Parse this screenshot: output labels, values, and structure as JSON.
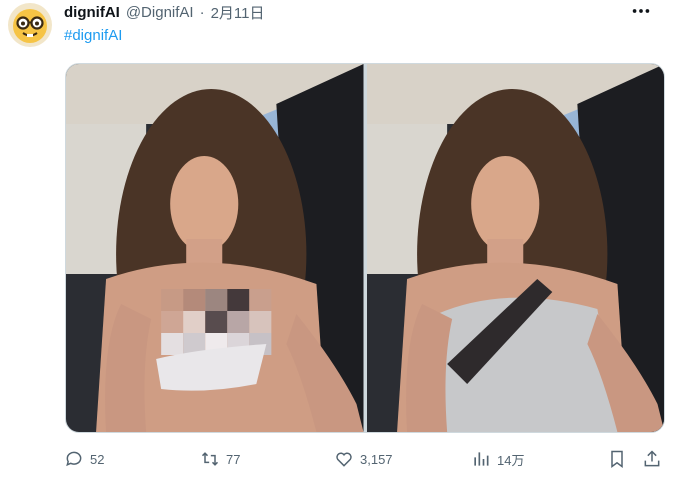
{
  "author": {
    "display_name": "dignifAI",
    "handle": "@DignifAI",
    "separator": "·",
    "date": "2月11日",
    "avatar_icon": "nerd-face-emoji"
  },
  "post": {
    "hashtag": "#dignifAI",
    "media": [
      {
        "name": "photo-original",
        "description_icon": "photo"
      },
      {
        "name": "photo-edited",
        "description_icon": "photo"
      }
    ]
  },
  "actions": {
    "reply_count": "52",
    "repost_count": "77",
    "like_count": "3,157",
    "views_count": "14万",
    "icons": [
      "reply-icon",
      "repost-icon",
      "like-icon",
      "views-icon",
      "bookmark-icon",
      "share-icon"
    ]
  },
  "colors": {
    "link_blue": "#1d9bf0",
    "text_secondary": "#536471",
    "text_primary": "#0f1419"
  }
}
